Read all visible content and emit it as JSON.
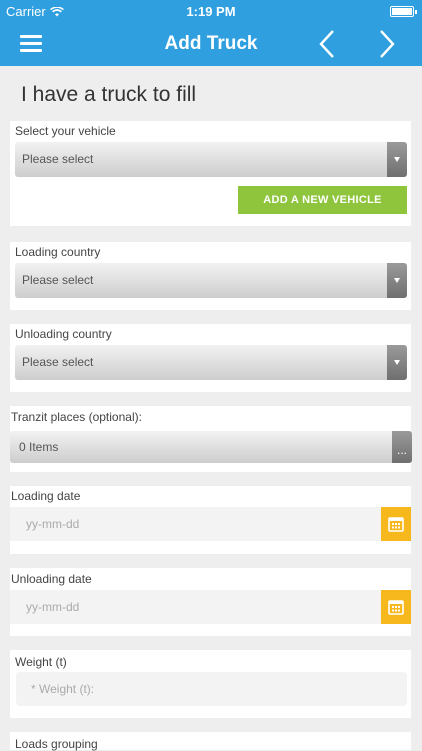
{
  "status_bar": {
    "carrier": "Carrier",
    "time": "1:19 PM"
  },
  "nav": {
    "title": "Add Truck"
  },
  "page": {
    "heading": "I have a truck to fill"
  },
  "vehicle": {
    "label": "Select your vehicle",
    "value": "Please select",
    "add_button": "ADD A NEW VEHICLE"
  },
  "loading_country": {
    "label": "Loading country",
    "value": "Please select"
  },
  "unloading_country": {
    "label": "Unloading country",
    "value": "Please select"
  },
  "tranzit": {
    "label": "Tranzit places (optional):",
    "value": "0 Items",
    "more": "..."
  },
  "loading_date": {
    "label": "Loading date",
    "placeholder": "yy-mm-dd"
  },
  "unloading_date": {
    "label": "Unloading date",
    "placeholder": "yy-mm-dd"
  },
  "weight": {
    "label": "Weight (t)",
    "placeholder": "* Weight (t):"
  },
  "loads_grouping": {
    "label": "Loads grouping"
  },
  "colors": {
    "nav": "#2f9fdf",
    "add_button": "#8fc53d",
    "calendar": "#f7b81d"
  },
  "icons": {
    "menu": "hamburger-icon",
    "prev": "chevron-left-icon",
    "next": "chevron-right-icon",
    "calendar": "calendar-icon",
    "wifi": "wifi-icon",
    "battery": "battery-icon"
  }
}
